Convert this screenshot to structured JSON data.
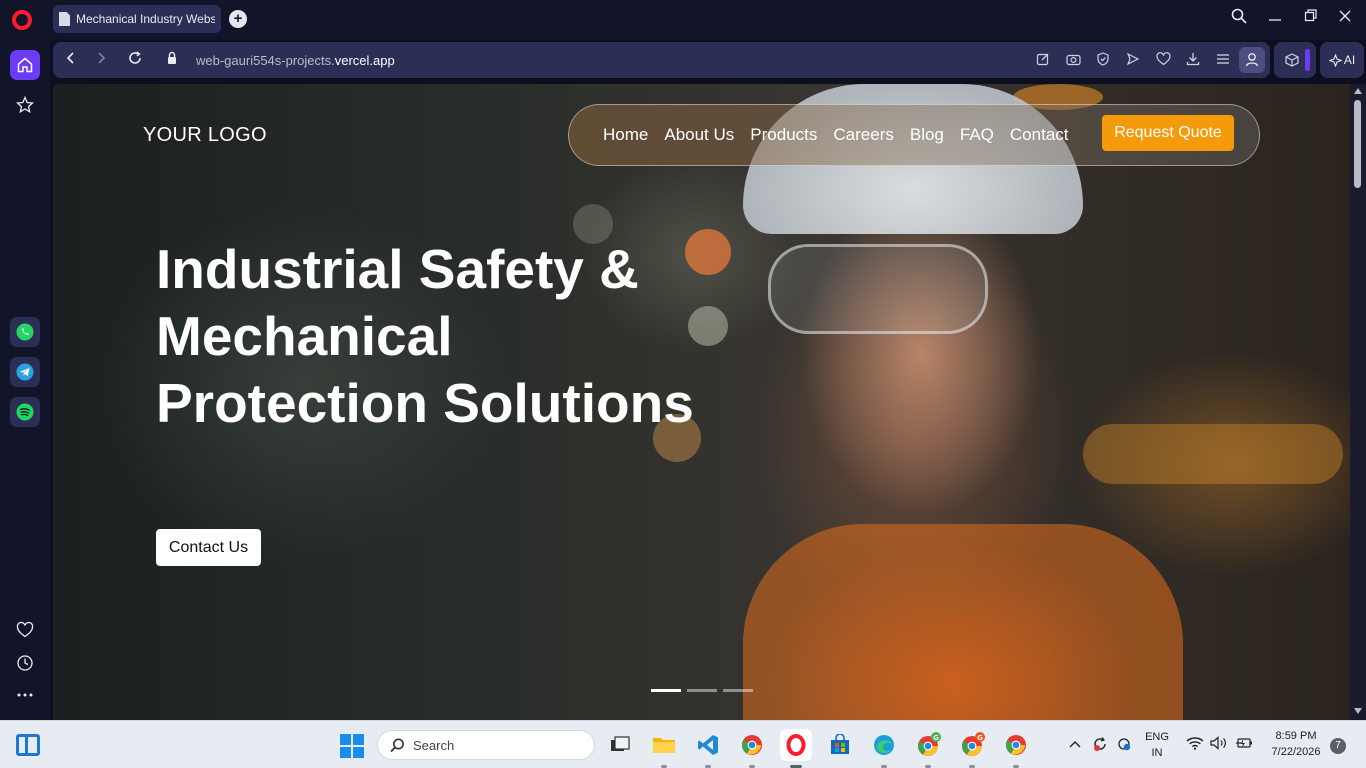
{
  "browser": {
    "tab_title": "Mechanical Industry Website",
    "new_tab": "+",
    "url_prefix": "web-gauri554s-projects.",
    "url_domain": "vercel.app",
    "ai_label": "AI",
    "accent": "#6a3cf5"
  },
  "site": {
    "logo": "YOUR LOGO",
    "nav": [
      "Home",
      "About Us",
      "Products",
      "Careers",
      "Blog",
      "FAQ",
      "Contact"
    ],
    "cta_label": "Request Quote",
    "cta_color": "#f59a0b",
    "hero_title": "Industrial Safety & Mechanical Protection Solutions",
    "hero_button": "Contact Us",
    "slide_active": 1,
    "slide_count": 3
  },
  "sidebar": {
    "items": [
      "home-icon",
      "star-icon",
      "whatsapp-icon",
      "telegram-icon",
      "spotify-icon",
      "heart-icon",
      "history-icon",
      "more-icon"
    ]
  },
  "taskbar": {
    "search_placeholder": "Search",
    "lang_top": "ENG",
    "lang_bottom": "IN",
    "time": "8:59 PM",
    "date": "7/22/2026",
    "notification_count": "7"
  }
}
